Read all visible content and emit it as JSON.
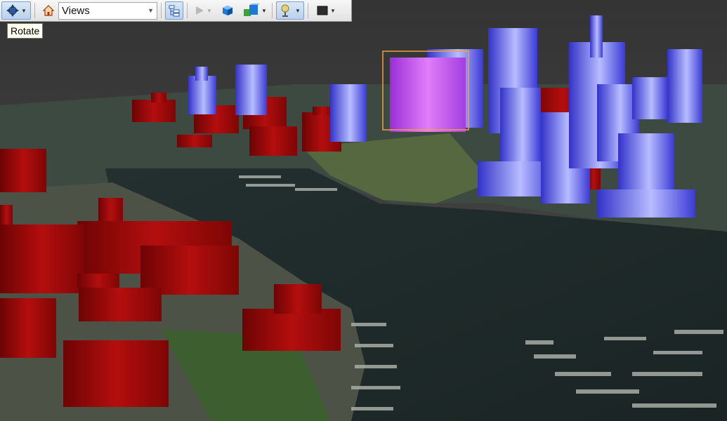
{
  "toolbar": {
    "navigate_tool": "navigate-icon",
    "home": "home-icon",
    "views_value": "Views",
    "table_of_contents": "hierarchy-icon",
    "play": "play-icon",
    "layer_tool": "blue-cube-icon",
    "extrusion_tool": "cubes-icon",
    "lighting_tool": "lamp-icon",
    "color_tool": "color-swatch-icon"
  },
  "tooltip": {
    "text": "Rotate"
  },
  "colors": {
    "sky": "#3c3c3c",
    "water": "#1e2b2b",
    "land": "#465043",
    "building_red": "#a30a0a",
    "building_blue": "#4b4df5",
    "building_selected": "#c24ef0",
    "selection_box": "#f0a040"
  }
}
